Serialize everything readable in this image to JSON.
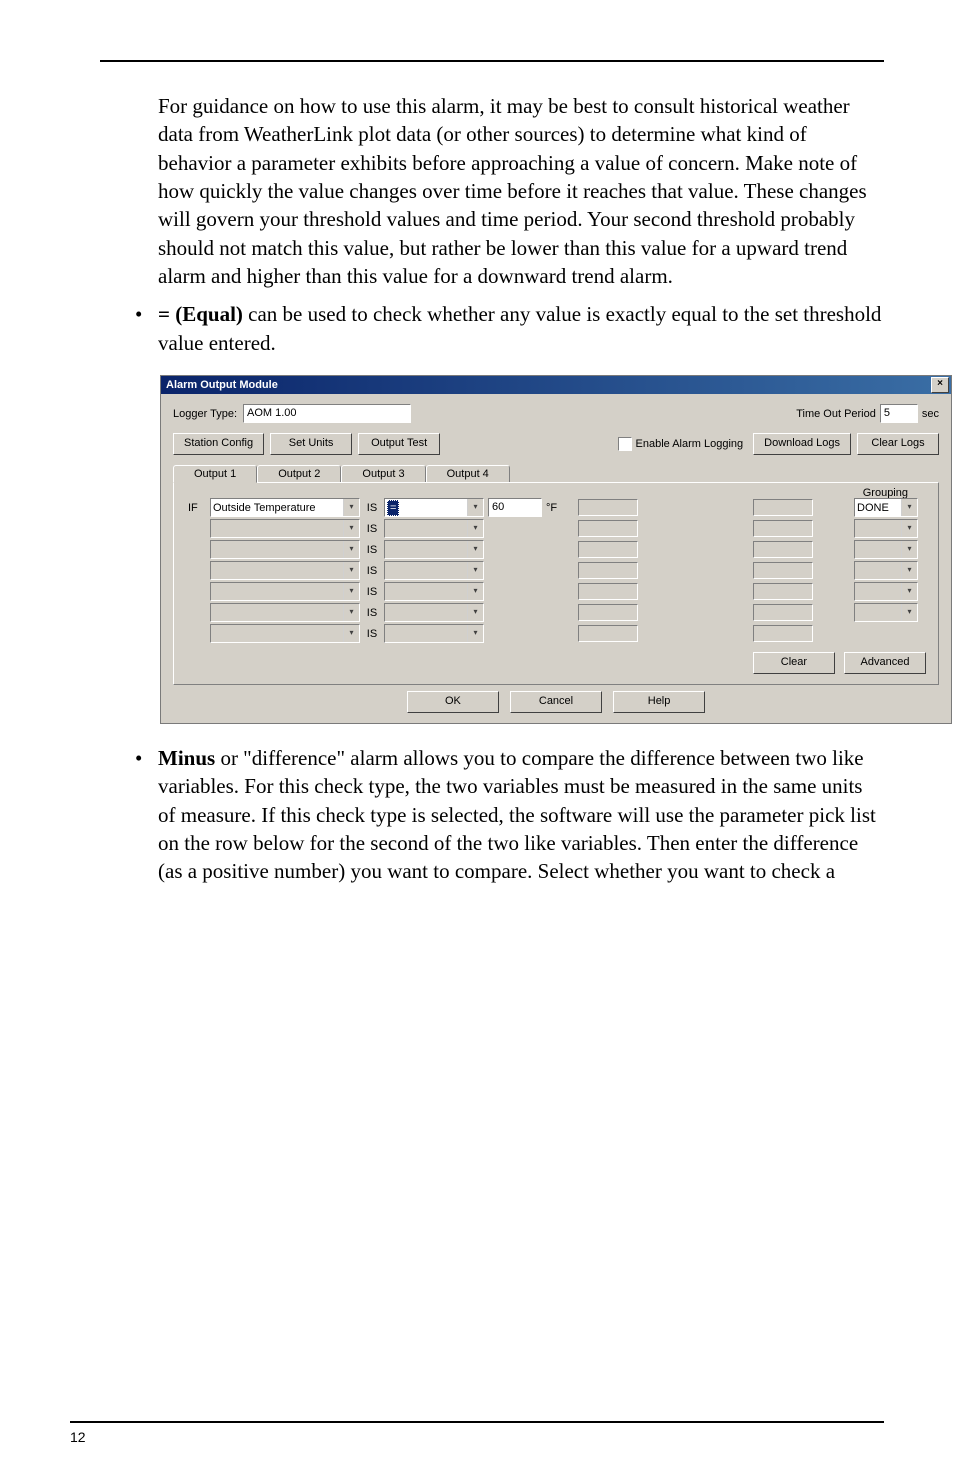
{
  "para1": "For guidance on how to use this alarm, it may be best to consult historical weather data from WeatherLink plot data (or other sources) to determine what kind of behavior a parameter exhibits before approaching a value of concern. Make note of how quickly the value changes over time before it reaches that value. These changes will govern your threshold values and time period. Your second threshold probably should not match this value, but rather be lower than this value for a upward trend alarm and higher than this value for a downward trend alarm.",
  "bullet_equal_prefix": "= (Equal)",
  "bullet_equal_rest": " can be used to check whether any value is exactly equal to the set threshold value entered.",
  "bullet_minus_prefix": "Minus",
  "bullet_minus_rest": " or \"difference\" alarm allows you to compare the difference between two like variables. For this check type, the two variables must be measured in the same units of measure. If this check type is selected, the software will use the parameter pick list on the row below for the second of the two like variables. Then enter the difference (as a positive number) you want to compare. Select whether you want to check a",
  "dialog": {
    "title": "Alarm Output Module",
    "logger_type_label": "Logger Type:",
    "logger_type_value": "AOM  1.00",
    "timeout_label": "Time Out Period",
    "timeout_value": "5",
    "timeout_unit": "sec",
    "station_config": "Station Config",
    "set_units": "Set Units",
    "output_test": "Output Test",
    "enable_alarm": "Enable Alarm Logging",
    "download_logs": "Download Logs",
    "clear_logs": "Clear Logs",
    "tabs": [
      "Output 1",
      "Output 2",
      "Output 3",
      "Output 4"
    ],
    "grouping_label": "Grouping",
    "if_label": "IF",
    "is_label": "IS",
    "row1_param": "Outside Temperature",
    "row1_op": "=",
    "row1_val": "60",
    "row1_unit": "°F",
    "row1_group": "DONE",
    "clear_btn": "Clear",
    "advanced_btn": "Advanced",
    "ok": "OK",
    "cancel": "Cancel",
    "help": "Help"
  },
  "pagenum": "12"
}
